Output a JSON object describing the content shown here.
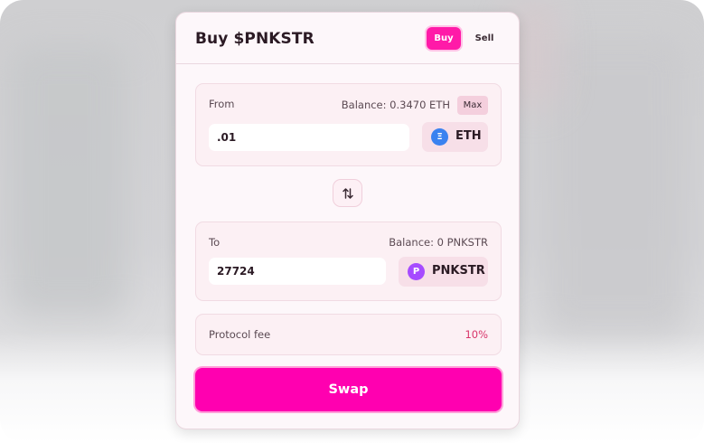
{
  "header": {
    "title": "Buy $PNKSTR",
    "tabs": [
      {
        "label": "Buy",
        "active": true
      },
      {
        "label": "Sell",
        "active": false
      }
    ]
  },
  "from": {
    "label": "From",
    "balance": "Balance: 0.3470 ETH",
    "max_label": "Max",
    "amount": ".01",
    "token": {
      "symbol": "ETH",
      "icon_glyph": "Ξ",
      "icon": "ethereum-icon",
      "color": "#3a82f0"
    }
  },
  "switch": {
    "icon": "swap-arrows-icon"
  },
  "to": {
    "label": "To",
    "balance": "Balance: 0 PNKSTR",
    "amount": "27724",
    "token": {
      "symbol": "PNKSTR",
      "icon_glyph": "P",
      "icon": "pnkstr-icon",
      "color": "#a64bff"
    }
  },
  "fee": {
    "label": "Protocol fee",
    "value": "10%"
  },
  "swap_button": {
    "label": "Swap"
  },
  "colors": {
    "accent": "#ff00b0",
    "fee_value": "#d8356a",
    "card_bg": "#fdf7fa"
  }
}
